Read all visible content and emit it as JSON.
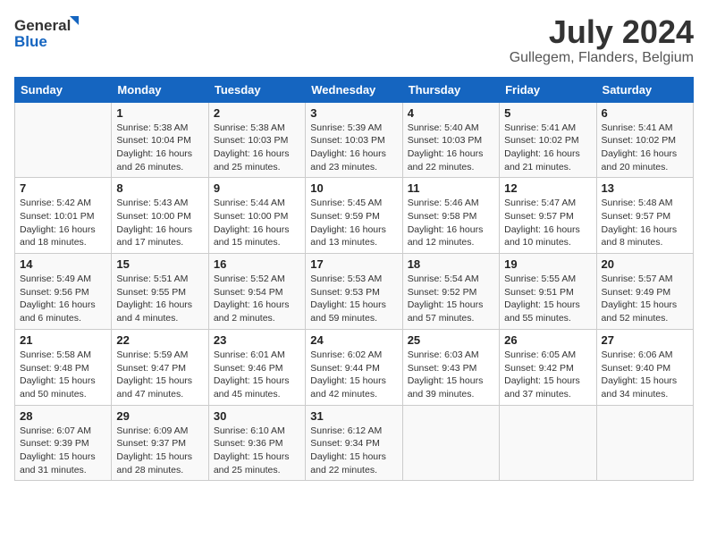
{
  "header": {
    "logo_line1": "General",
    "logo_line2": "Blue",
    "month_year": "July 2024",
    "location": "Gullegem, Flanders, Belgium"
  },
  "days_of_week": [
    "Sunday",
    "Monday",
    "Tuesday",
    "Wednesday",
    "Thursday",
    "Friday",
    "Saturday"
  ],
  "weeks": [
    [
      {
        "day": "",
        "detail": ""
      },
      {
        "day": "1",
        "detail": "Sunrise: 5:38 AM\nSunset: 10:04 PM\nDaylight: 16 hours\nand 26 minutes."
      },
      {
        "day": "2",
        "detail": "Sunrise: 5:38 AM\nSunset: 10:03 PM\nDaylight: 16 hours\nand 25 minutes."
      },
      {
        "day": "3",
        "detail": "Sunrise: 5:39 AM\nSunset: 10:03 PM\nDaylight: 16 hours\nand 23 minutes."
      },
      {
        "day": "4",
        "detail": "Sunrise: 5:40 AM\nSunset: 10:03 PM\nDaylight: 16 hours\nand 22 minutes."
      },
      {
        "day": "5",
        "detail": "Sunrise: 5:41 AM\nSunset: 10:02 PM\nDaylight: 16 hours\nand 21 minutes."
      },
      {
        "day": "6",
        "detail": "Sunrise: 5:41 AM\nSunset: 10:02 PM\nDaylight: 16 hours\nand 20 minutes."
      }
    ],
    [
      {
        "day": "7",
        "detail": "Sunrise: 5:42 AM\nSunset: 10:01 PM\nDaylight: 16 hours\nand 18 minutes."
      },
      {
        "day": "8",
        "detail": "Sunrise: 5:43 AM\nSunset: 10:00 PM\nDaylight: 16 hours\nand 17 minutes."
      },
      {
        "day": "9",
        "detail": "Sunrise: 5:44 AM\nSunset: 10:00 PM\nDaylight: 16 hours\nand 15 minutes."
      },
      {
        "day": "10",
        "detail": "Sunrise: 5:45 AM\nSunset: 9:59 PM\nDaylight: 16 hours\nand 13 minutes."
      },
      {
        "day": "11",
        "detail": "Sunrise: 5:46 AM\nSunset: 9:58 PM\nDaylight: 16 hours\nand 12 minutes."
      },
      {
        "day": "12",
        "detail": "Sunrise: 5:47 AM\nSunset: 9:57 PM\nDaylight: 16 hours\nand 10 minutes."
      },
      {
        "day": "13",
        "detail": "Sunrise: 5:48 AM\nSunset: 9:57 PM\nDaylight: 16 hours\nand 8 minutes."
      }
    ],
    [
      {
        "day": "14",
        "detail": "Sunrise: 5:49 AM\nSunset: 9:56 PM\nDaylight: 16 hours\nand 6 minutes."
      },
      {
        "day": "15",
        "detail": "Sunrise: 5:51 AM\nSunset: 9:55 PM\nDaylight: 16 hours\nand 4 minutes."
      },
      {
        "day": "16",
        "detail": "Sunrise: 5:52 AM\nSunset: 9:54 PM\nDaylight: 16 hours\nand 2 minutes."
      },
      {
        "day": "17",
        "detail": "Sunrise: 5:53 AM\nSunset: 9:53 PM\nDaylight: 15 hours\nand 59 minutes."
      },
      {
        "day": "18",
        "detail": "Sunrise: 5:54 AM\nSunset: 9:52 PM\nDaylight: 15 hours\nand 57 minutes."
      },
      {
        "day": "19",
        "detail": "Sunrise: 5:55 AM\nSunset: 9:51 PM\nDaylight: 15 hours\nand 55 minutes."
      },
      {
        "day": "20",
        "detail": "Sunrise: 5:57 AM\nSunset: 9:49 PM\nDaylight: 15 hours\nand 52 minutes."
      }
    ],
    [
      {
        "day": "21",
        "detail": "Sunrise: 5:58 AM\nSunset: 9:48 PM\nDaylight: 15 hours\nand 50 minutes."
      },
      {
        "day": "22",
        "detail": "Sunrise: 5:59 AM\nSunset: 9:47 PM\nDaylight: 15 hours\nand 47 minutes."
      },
      {
        "day": "23",
        "detail": "Sunrise: 6:01 AM\nSunset: 9:46 PM\nDaylight: 15 hours\nand 45 minutes."
      },
      {
        "day": "24",
        "detail": "Sunrise: 6:02 AM\nSunset: 9:44 PM\nDaylight: 15 hours\nand 42 minutes."
      },
      {
        "day": "25",
        "detail": "Sunrise: 6:03 AM\nSunset: 9:43 PM\nDaylight: 15 hours\nand 39 minutes."
      },
      {
        "day": "26",
        "detail": "Sunrise: 6:05 AM\nSunset: 9:42 PM\nDaylight: 15 hours\nand 37 minutes."
      },
      {
        "day": "27",
        "detail": "Sunrise: 6:06 AM\nSunset: 9:40 PM\nDaylight: 15 hours\nand 34 minutes."
      }
    ],
    [
      {
        "day": "28",
        "detail": "Sunrise: 6:07 AM\nSunset: 9:39 PM\nDaylight: 15 hours\nand 31 minutes."
      },
      {
        "day": "29",
        "detail": "Sunrise: 6:09 AM\nSunset: 9:37 PM\nDaylight: 15 hours\nand 28 minutes."
      },
      {
        "day": "30",
        "detail": "Sunrise: 6:10 AM\nSunset: 9:36 PM\nDaylight: 15 hours\nand 25 minutes."
      },
      {
        "day": "31",
        "detail": "Sunrise: 6:12 AM\nSunset: 9:34 PM\nDaylight: 15 hours\nand 22 minutes."
      },
      {
        "day": "",
        "detail": ""
      },
      {
        "day": "",
        "detail": ""
      },
      {
        "day": "",
        "detail": ""
      }
    ]
  ]
}
